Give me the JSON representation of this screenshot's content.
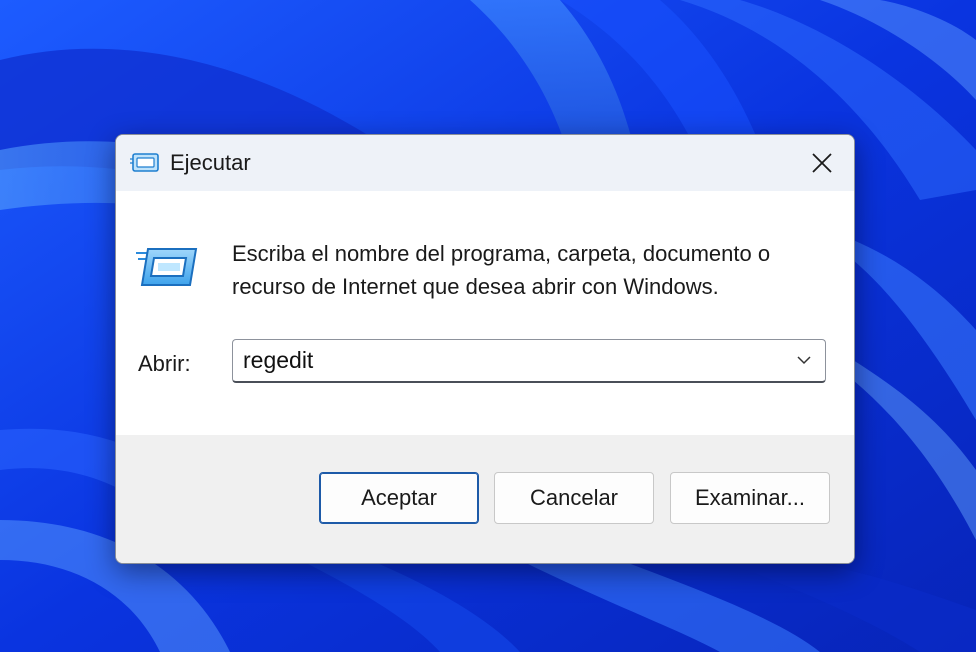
{
  "dialog": {
    "title": "Ejecutar",
    "title_icon": "run-icon",
    "close_icon": "close-icon",
    "description": "Escriba el nombre del programa, carpeta, documento o recurso de Internet que desea abrir con Windows.",
    "open_label": "Abrir:",
    "open_value": "regedit",
    "dropdown_icon": "chevron-down-icon",
    "buttons": {
      "ok": "Aceptar",
      "cancel": "Cancelar",
      "browse": "Examinar..."
    }
  },
  "colors": {
    "wallpaper_base": "#0a2fd6",
    "titlebar": "#eef2f8",
    "footer": "#f0f0f0",
    "primary_border": "#1d5aa8"
  }
}
